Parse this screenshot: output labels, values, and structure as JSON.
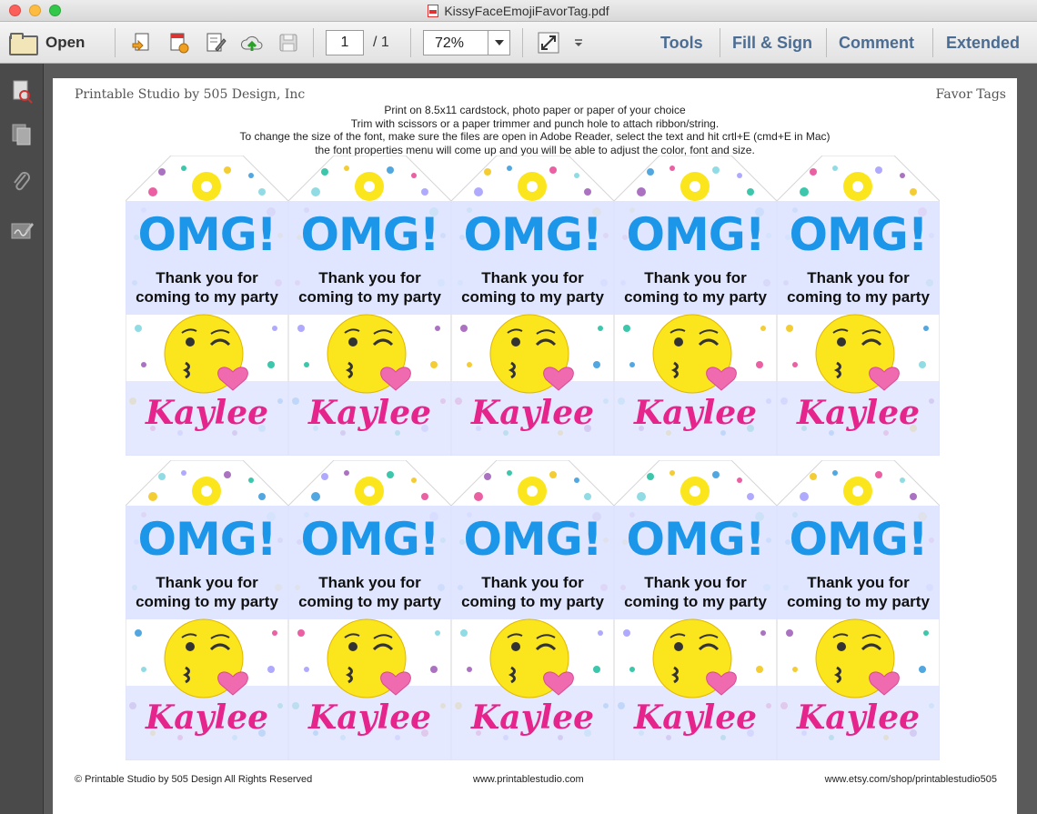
{
  "window": {
    "title": "KissyFaceEmojiFavorTag.pdf"
  },
  "toolbar": {
    "open_label": "Open",
    "page_current": "1",
    "page_total": "/ 1",
    "zoom": "72%",
    "tabs": [
      "Tools",
      "Fill & Sign",
      "Comment",
      "Extended"
    ]
  },
  "sidebar": {
    "icons": [
      "page-thumbnails-icon",
      "copy-pages-icon",
      "attachment-icon",
      "signature-icon"
    ]
  },
  "document": {
    "header_left": "Printable Studio by 505 Design, Inc",
    "header_right": "Favor Tags",
    "instructions": [
      "Print on 8.5x11 cardstock, photo paper or paper of your choice",
      "Trim with scissors or a paper trimmer and punch hole to attach ribbon/string.",
      "To change the size of the font, make sure the files are open in Adobe Reader, select the text and hit crtl+E (cmd+E in Mac)",
      "the font properties menu will come up and you will be able to adjust the color, font and size."
    ],
    "footer_left": "© Printable Studio by 505 Design All Rights Reserved",
    "footer_mid": "www.printablestudio.com",
    "footer_right": "www.etsy.com/shop/printablestudio505",
    "tag": {
      "headline": "OMG!",
      "line1": "Thank you for",
      "line2": "coming to my party",
      "name": "Kaylee"
    },
    "tag_count": 10,
    "colors": {
      "headline": "#1b96e8",
      "name": "#e6258c",
      "band": "#dde3ff",
      "emoji": "#fbe51d",
      "heart": "#f06ab0"
    }
  }
}
